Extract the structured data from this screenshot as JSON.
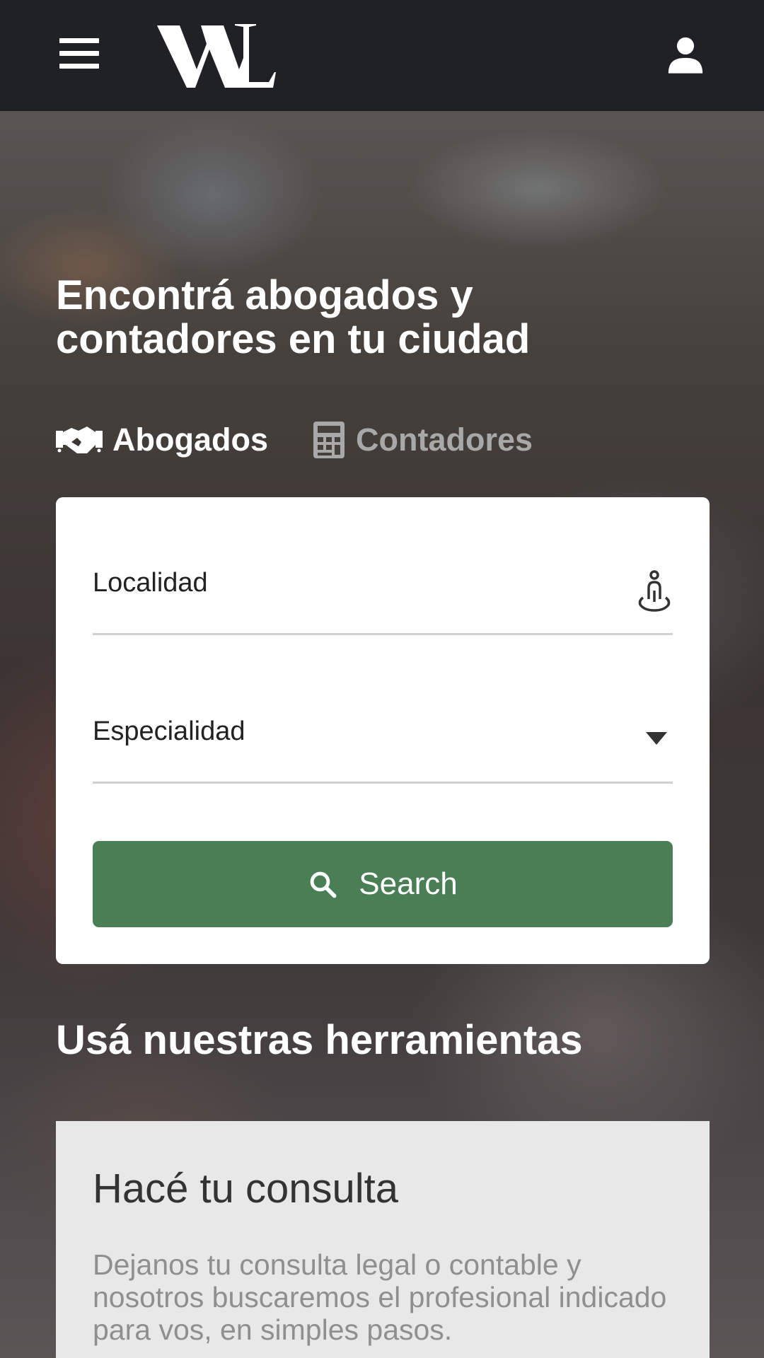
{
  "header": {
    "logo_text": "WL",
    "menu_icon": "hamburger-menu-icon",
    "user_icon": "user-icon"
  },
  "hero": {
    "title": "Encontrá abogados y contadores en tu ciudad",
    "tabs": [
      {
        "label": "Abogados",
        "icon": "handshake-icon",
        "active": true
      },
      {
        "label": "Contadores",
        "icon": "calculator-icon",
        "active": false
      }
    ]
  },
  "search_form": {
    "localidad_label": "Localidad",
    "localidad_icon": "location-person-icon",
    "especialidad_label": "Especialidad",
    "especialidad_icon": "dropdown-arrow-icon",
    "search_button_label": "Search",
    "search_icon": "search-icon"
  },
  "tools": {
    "title": "Usá nuestras herramientas",
    "consulta_title": "Hacé tu consulta",
    "consulta_text": "Dejanos tu consulta legal o contable y nosotros buscaremos el profesional indicado para vos, en simples pasos."
  },
  "colors": {
    "header_bg": "#202125",
    "accent_green": "#4a7e55",
    "card_bg": "#ffffff",
    "tool_card_bg": "#e8e8e8",
    "inactive_tab": "#a8a8a8"
  }
}
